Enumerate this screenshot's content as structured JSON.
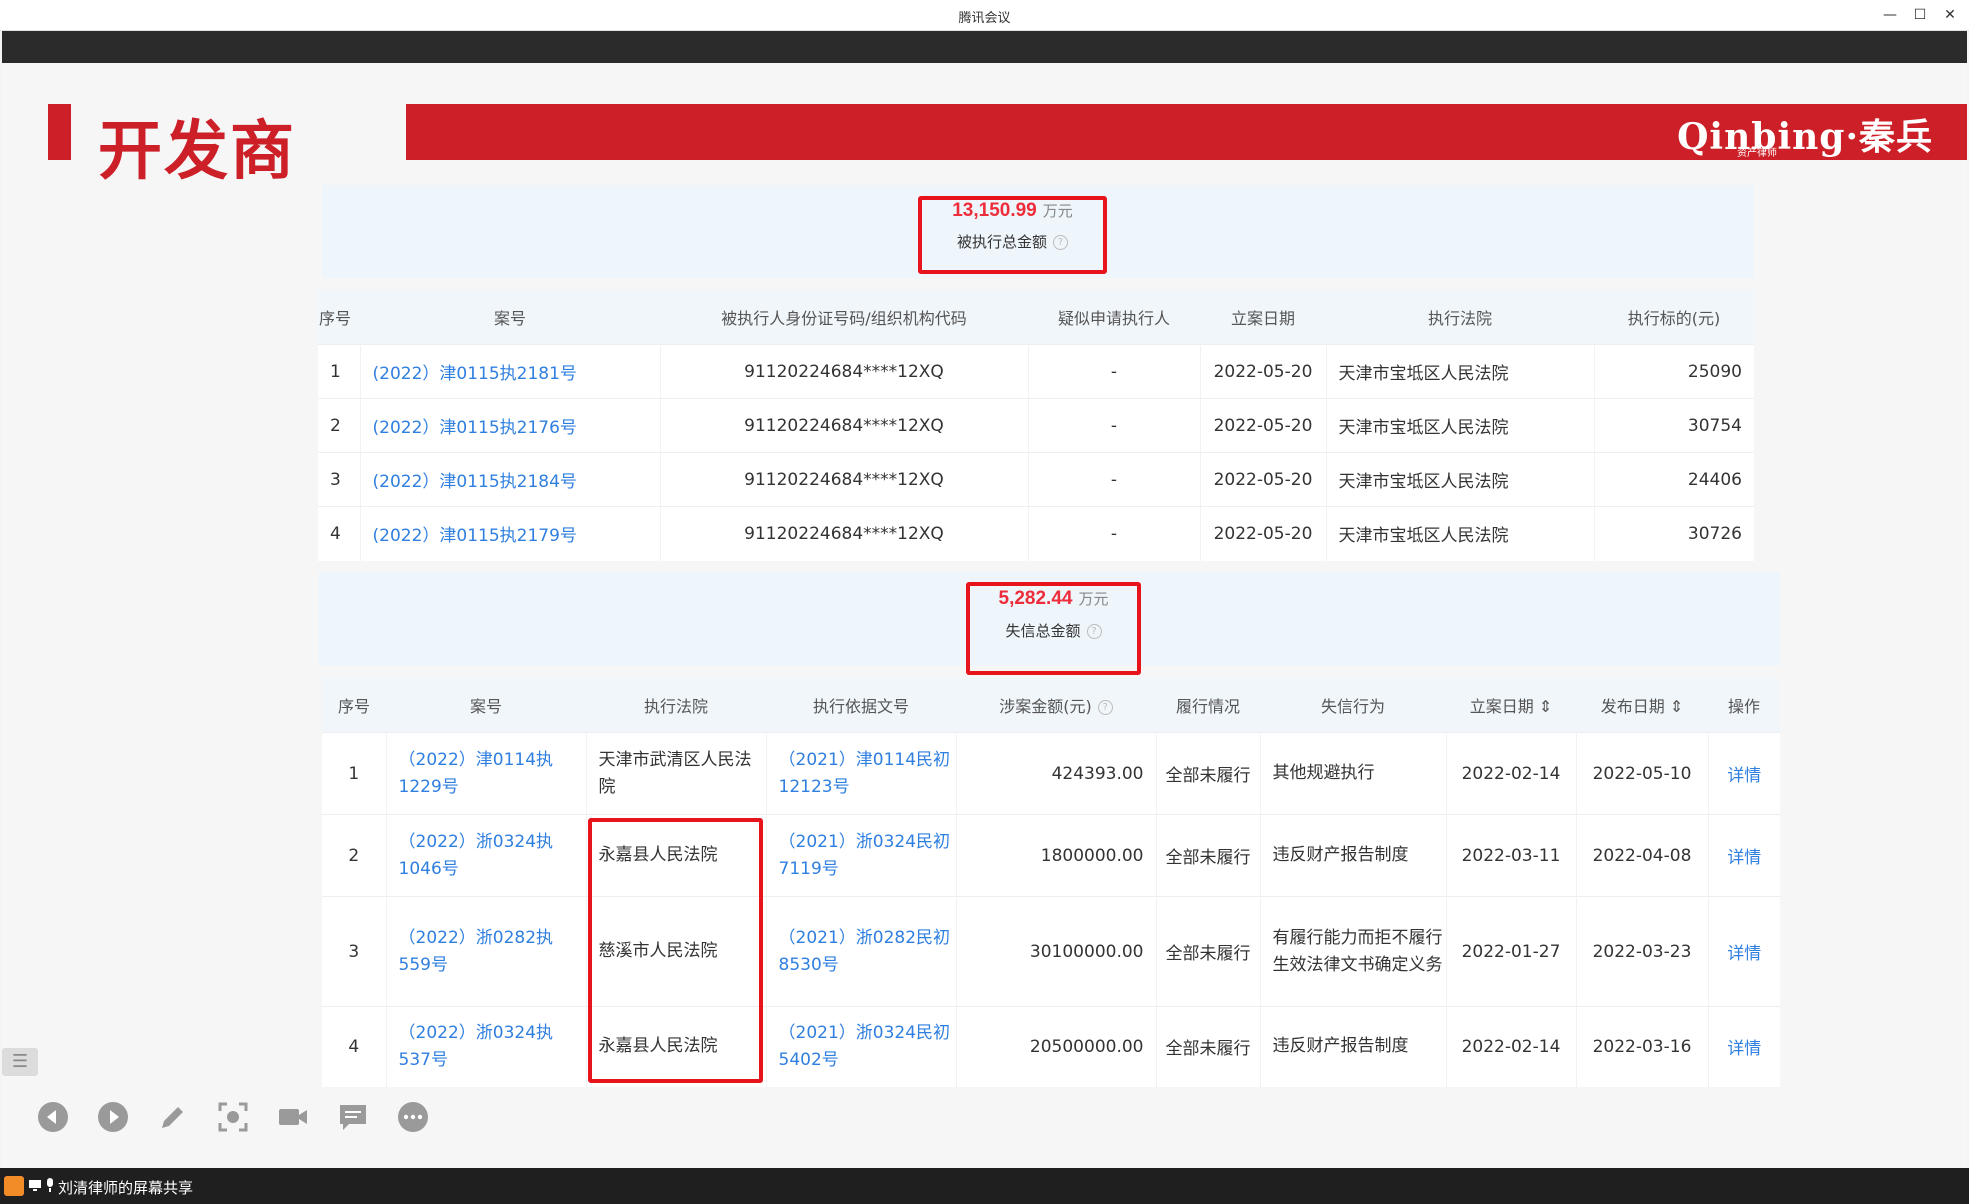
{
  "window": {
    "title": "腾讯会议",
    "min": "—",
    "max": "☐",
    "close": "✕"
  },
  "slide": {
    "heading": "开发商",
    "logo": "Qinbing·秦兵",
    "logo_sub": "资产律师"
  },
  "exec_summary": {
    "amount": "13,150.99",
    "unit": "万元",
    "label": "被执行总金额"
  },
  "exec_table": {
    "headers": [
      "序号",
      "案号",
      "被执行人身份证号码/组织机构代码",
      "疑似申请执行人",
      "立案日期",
      "执行法院",
      "执行标的(元)"
    ],
    "rows": [
      [
        "1",
        "(2022）津0115执2181号",
        "91120224684****12XQ",
        "-",
        "2022-05-20",
        "天津市宝坻区人民法院",
        "25090"
      ],
      [
        "2",
        "(2022）津0115执2176号",
        "91120224684****12XQ",
        "-",
        "2022-05-20",
        "天津市宝坻区人民法院",
        "30754"
      ],
      [
        "3",
        "(2022）津0115执2184号",
        "91120224684****12XQ",
        "-",
        "2022-05-20",
        "天津市宝坻区人民法院",
        "24406"
      ],
      [
        "4",
        "(2022）津0115执2179号",
        "91120224684****12XQ",
        "-",
        "2022-05-20",
        "天津市宝坻区人民法院",
        "30726"
      ]
    ]
  },
  "dishonest_summary": {
    "amount": "5,282.44",
    "unit": "万元",
    "label": "失信总金额"
  },
  "dishonest_table": {
    "headers": [
      "序号",
      "案号",
      "执行法院",
      "执行依据文号",
      "涉案金额(元)",
      "履行情况",
      "失信行为",
      "立案日期 ⇕",
      "发布日期 ⇕",
      "操作"
    ],
    "rows": [
      [
        "1",
        "（2022）津0114执1229号",
        "天津市武清区人民法院",
        "（2021）津0114民初12123号",
        "424393.00",
        "全部未履行",
        "其他规避执行",
        "2022-02-14",
        "2022-05-10",
        "详情"
      ],
      [
        "2",
        "（2022）浙0324执1046号",
        "永嘉县人民法院",
        "（2021）浙0324民初7119号",
        "1800000.00",
        "全部未履行",
        "违反财产报告制度",
        "2022-03-11",
        "2022-04-08",
        "详情"
      ],
      [
        "3",
        "（2022）浙0282执559号",
        "慈溪市人民法院",
        "（2021）浙0282民初8530号",
        "30100000.00",
        "全部未履行",
        "有履行能力而拒不履行生效法律文书确定义务",
        "2022-01-27",
        "2022-03-23",
        "详情"
      ],
      [
        "4",
        "（2022）浙0324执537号",
        "永嘉县人民法院",
        "（2021）浙0324民初5402号",
        "20500000.00",
        "全部未履行",
        "违反财产报告制度",
        "2022-02-14",
        "2022-03-16",
        "详情"
      ]
    ]
  },
  "toolbar": [
    "prev-icon",
    "next-icon",
    "pen-icon",
    "screenshot-icon",
    "camera-icon",
    "chat-icon",
    "more-icon"
  ],
  "status": {
    "share_text": "刘清律师的屏幕共享"
  },
  "colors": {
    "brand_red": "#cc1f27",
    "highlight_red": "#e8141c",
    "link_blue": "#2f7fe0"
  }
}
